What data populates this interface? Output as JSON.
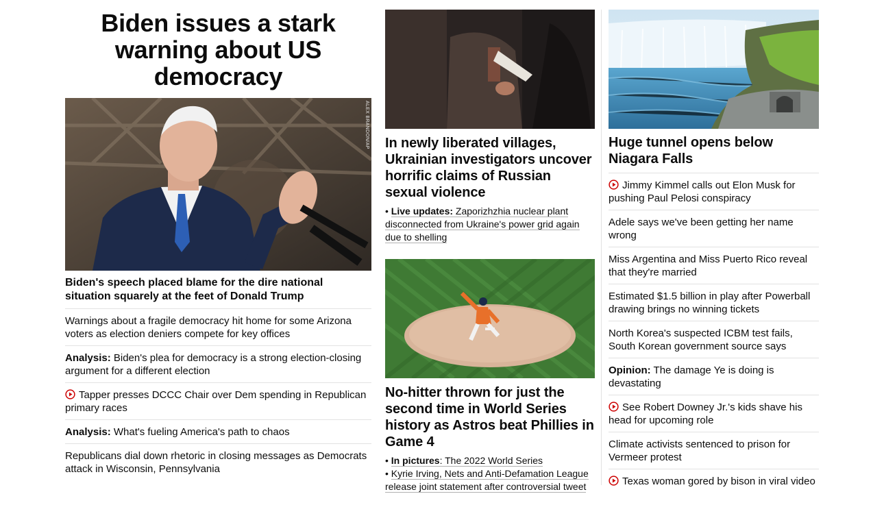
{
  "colors": {
    "video_red": "#cc0000",
    "text": "#0c0c0c",
    "divider": "#e2e2e2"
  },
  "lead": {
    "headline": "Biden issues a stark warning about US democracy",
    "photo_credit": "ALEX BRANDON/AP",
    "caption": "Biden's speech placed blame for the dire national situation squarely at the feet of Donald Trump",
    "items": [
      {
        "prefix": "",
        "text": "Warnings about a fragile democracy hit home for some Arizona voters as election deniers compete for key offices",
        "icon": ""
      },
      {
        "prefix": "Analysis:",
        "text": " Biden's plea for democracy is a strong election-closing argument for a different election",
        "icon": ""
      },
      {
        "prefix": "",
        "text": "Tapper presses DCCC Chair over Dem spending in Republican primary races",
        "icon": "video-play-icon"
      },
      {
        "prefix": "Analysis:",
        "text": " What's fueling America's path to chaos",
        "icon": ""
      },
      {
        "prefix": "",
        "text": "Republicans dial down rhetoric in closing messages as Democrats attack in Wisconsin, Pennsylvania",
        "icon": ""
      }
    ]
  },
  "middle": {
    "story1": {
      "title": "In newly liberated villages, Ukrainian investigators uncover horrific claims of Russian sexual violence",
      "bullet": "•",
      "sub_prefix": "Live updates:",
      "sub_text": " Zaporizhzhia nuclear plant disconnected from Ukraine's power grid again due to shelling"
    },
    "story2": {
      "title": "No-hitter thrown for just the second time in World Series history as Astros beat Phillies in Game 4",
      "bullet": "•",
      "sub1_prefix": "In pictures",
      "sub1_text": ": The 2022 World Series",
      "sub2_text": "Kyrie Irving, Nets and Anti-Defamation League release joint statement after controversial tweet"
    }
  },
  "right": {
    "title": "Huge tunnel opens below Niagara Falls",
    "items": [
      {
        "prefix": "",
        "text": "Jimmy Kimmel calls out Elon Musk for pushing Paul Pelosi conspiracy",
        "icon": "video-play-icon"
      },
      {
        "prefix": "",
        "text": "Adele says we've been getting her name wrong",
        "icon": ""
      },
      {
        "prefix": "",
        "text": "Miss Argentina and Miss Puerto Rico reveal that they're married",
        "icon": ""
      },
      {
        "prefix": "",
        "text": "Estimated $1.5 billion in play after Powerball drawing brings no winning tickets",
        "icon": ""
      },
      {
        "prefix": "",
        "text": "North Korea's suspected ICBM test fails, South Korean government source says",
        "icon": ""
      },
      {
        "prefix": "Opinion:",
        "text": " The damage Ye is doing is devastating",
        "icon": ""
      },
      {
        "prefix": "",
        "text": "See Robert Downey Jr.'s kids shave his head for upcoming role",
        "icon": "video-play-icon"
      },
      {
        "prefix": "",
        "text": "Climate activists sentenced to prison for Vermeer protest",
        "icon": ""
      },
      {
        "prefix": "",
        "text": "Texas woman gored by bison in viral video",
        "icon": "video-play-icon"
      }
    ]
  }
}
